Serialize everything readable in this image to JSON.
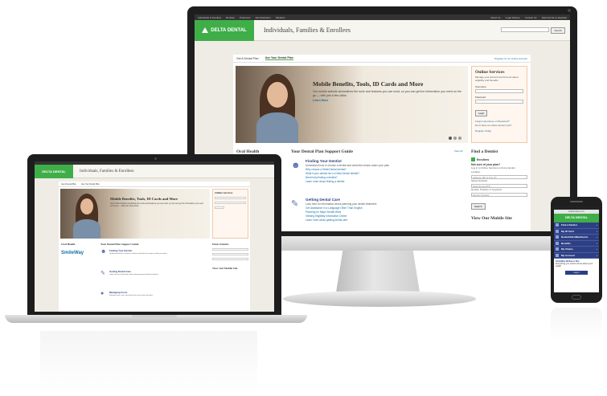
{
  "colors": {
    "brand_green": "#3fae49",
    "navy": "#2d3f84",
    "link_blue": "#1a6fa8"
  },
  "desktop": {
    "topbar_left": [
      "Individuals & Families",
      "Dentists",
      "Producers",
      "Administrators",
      "Students"
    ],
    "topbar_right": [
      "About Us",
      "Legal Notices",
      "Contact Us",
      "Sala Dental en Español"
    ],
    "logo": "DELTA DENTAL",
    "header_title": "Individuals, Families & Enrollees",
    "search_button": "Search",
    "tabs": [
      "Get A Dental Plan",
      "Use Your Dental Plan"
    ],
    "register_link": "Register for an Online Account",
    "hero": {
      "title": "Mobile Benefits, Tools, ID Cards and More",
      "body": "Our mobile website streamlines the tools and features you use most, so you can get the information you need on the go — with just a few clicks.",
      "link": "Learn More"
    },
    "online_services": {
      "title": "Online Services",
      "text": "Manage your account and find out about eligibility and benefits.",
      "username_label": "Username",
      "password_label": "Password",
      "login_button": "Login",
      "forgot": "Forgot Username or Password?",
      "no_account": "Don't have an online account yet?",
      "register": "Register Today"
    },
    "oral_health": "Oral Health",
    "guide_title": "Your Dental Plan Support Guide",
    "view_all": "View All",
    "guide_items": [
      {
        "title": "Finding Your Dentist",
        "sub": "Understand how to choose a dentist and what this means under your plan.",
        "links": [
          "Why choose a Delta Dental dentist?",
          "What if your dentist isn't a Delta Dental dentist?",
          "Need help finding a dentist?"
        ],
        "more": "Learn more about finding a dentist"
      },
      {
        "title": "Getting Dental Care",
        "sub": "Look here for information about planning your dental treatment.",
        "links": [
          "Get Assistance in a Language Other Than English",
          "Planning for Major Dental Work",
          "Viewing Eligibility Information Online"
        ],
        "more": "Learn more about getting dental care"
      }
    ],
    "find_dentist": {
      "title": "Find a Dentist",
      "enrollees": "Enrollees",
      "not_sure": "Not sure of your plan?",
      "login_text": "Log in to Online Services to find a dentist.",
      "location_label": "Location",
      "location_placeholder": "Address, ZIP or City, ST",
      "network_label": "Select Network",
      "network_value": "Delta Dental PPO",
      "practice_label": "Dentist, Practice or Keyword",
      "practice_placeholder": "Dentist, Practice",
      "search": "Search"
    },
    "mobile_site": "View Our Mobile Site"
  },
  "laptop": {
    "logo": "DELTA DENTAL",
    "header_title": "Individuals, Families & Enrollees",
    "tabs": [
      "Get A Dental Plan",
      "Use Your Dental Plan"
    ],
    "hero_title": "Mobile Benefits, Tools, ID Cards and More",
    "hero_body": "Our mobile website streamlines the tools and features you use most, so you can get the information you need on the go — with just a few clicks.",
    "side_title": "Online Services",
    "oral_health": "Oral Health",
    "smileway": "SmileWay",
    "guide_title": "Your Dental Plan Support Guide",
    "items": [
      {
        "title": "Finding Your Dentist",
        "sub": "Understand how to choose a dentist and what this means under your plan."
      },
      {
        "title": "Getting Dental Care",
        "sub": "Look here for information about planning your dental treatment."
      },
      {
        "title": "Managing Costs",
        "sub": "Estimate your costs and make the most of your benefits."
      }
    ],
    "right_title": "Find a Dentist",
    "right_title2": "View Our Mobile Site"
  },
  "phone": {
    "url": "deltadentalins.com",
    "logo": "DELTA DENTAL",
    "nav": [
      "Find a Dentist",
      "My ID Card",
      "Deductibles/Maximums",
      "Benefits",
      "My Claims",
      "My Account"
    ],
    "promo_title": "SmileWay Wellness Site",
    "promo_text": "Everything you need to know about your health",
    "login": "Log in"
  }
}
